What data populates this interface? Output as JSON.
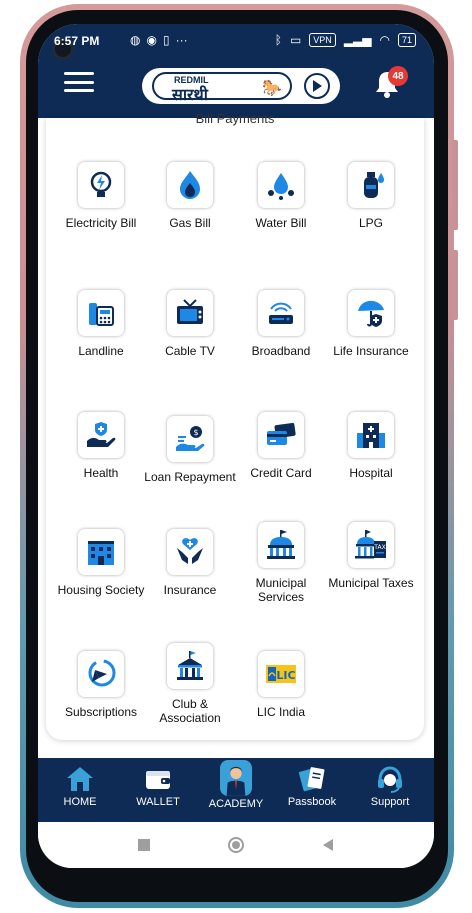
{
  "status_bar": {
    "time": "6:57 PM",
    "left_icons": [
      "messenger-icon",
      "cloud-icon",
      "whatsapp-icon",
      "sim-icon",
      "more-dots-icon"
    ],
    "vpn": "VPN",
    "battery": "71"
  },
  "header": {
    "logo_top": "REDMIL",
    "logo_main": "सारथी",
    "notification_count": "48"
  },
  "section": {
    "title": "Bill Payments"
  },
  "services": [
    {
      "label": "Electricity Bill",
      "icon": "electricity-icon"
    },
    {
      "label": "Gas Bill",
      "icon": "gas-flame-icon"
    },
    {
      "label": "Water Bill",
      "icon": "water-drop-icon"
    },
    {
      "label": "LPG",
      "icon": "lpg-cylinder-icon"
    },
    {
      "label": "Landline",
      "icon": "landline-phone-icon"
    },
    {
      "label": "Cable TV",
      "icon": "tv-icon"
    },
    {
      "label": "Broadband",
      "icon": "router-icon"
    },
    {
      "label": "Life Insurance",
      "icon": "umbrella-shield-icon"
    },
    {
      "label": "Health",
      "icon": "health-hand-icon"
    },
    {
      "label": "Loan Repayment",
      "icon": "loan-hand-icon"
    },
    {
      "label": "Credit Card",
      "icon": "credit-card-icon"
    },
    {
      "label": "Hospital",
      "icon": "hospital-icon"
    },
    {
      "label": "Housing Society",
      "icon": "building-icon"
    },
    {
      "label": "Insurance",
      "icon": "insurance-hands-icon"
    },
    {
      "label": "Municipal Services",
      "icon": "municipal-building-icon"
    },
    {
      "label": "Municipal Taxes",
      "icon": "municipal-tax-icon"
    },
    {
      "label": "Subscriptions",
      "icon": "subscription-icon"
    },
    {
      "label": "Club & Association",
      "icon": "club-building-icon"
    },
    {
      "label": "LIC India",
      "icon": "lic-logo-icon"
    }
  ],
  "bottom_nav": [
    {
      "label": "HOME",
      "icon": "home-icon"
    },
    {
      "label": "WALLET",
      "icon": "wallet-icon"
    },
    {
      "label": "ACADEMY",
      "icon": "academy-avatar-icon"
    },
    {
      "label": "Passbook",
      "icon": "passbook-icon"
    },
    {
      "label": "Support",
      "icon": "headset-icon"
    }
  ],
  "colors": {
    "brand_navy": "#0d2b54",
    "accent_blue": "#1e88e5",
    "badge_red": "#e53935"
  }
}
